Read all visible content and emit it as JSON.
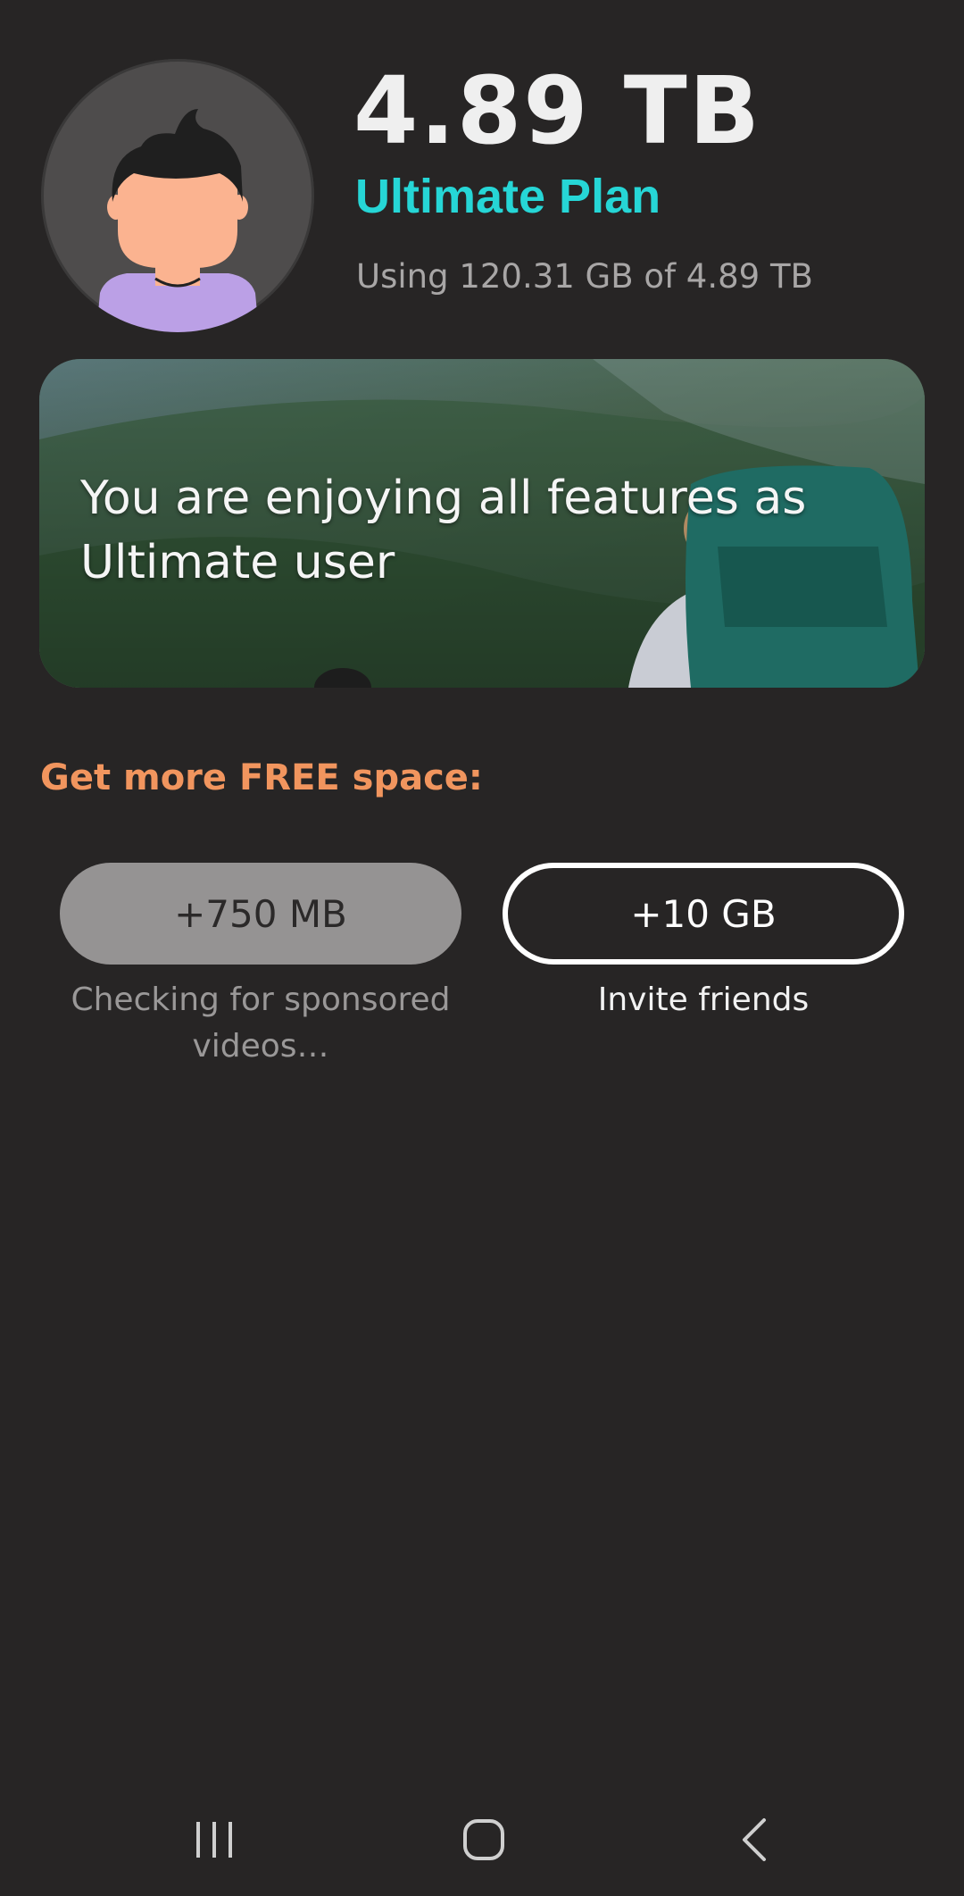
{
  "header": {
    "storage_total": "4.89 TB",
    "plan_name": "Ultimate Plan",
    "usage_text": "Using 120.31 GB of 4.89 TB"
  },
  "banner": {
    "message": "You are enjoying all features as Ultimate user"
  },
  "free_space": {
    "heading": "Get more FREE space:",
    "video_reward": {
      "label": "+750 MB",
      "caption": "Checking for sponsored videos…"
    },
    "invite_reward": {
      "label": "+10 GB",
      "caption": "Invite friends"
    }
  },
  "navbar": {
    "icons": [
      "recents-icon",
      "home-icon",
      "back-icon"
    ]
  },
  "colors": {
    "background": "#272525",
    "plan_accent": "#26d6d6",
    "heading_accent": "#f1955e",
    "video_button_bg": "#959393"
  }
}
